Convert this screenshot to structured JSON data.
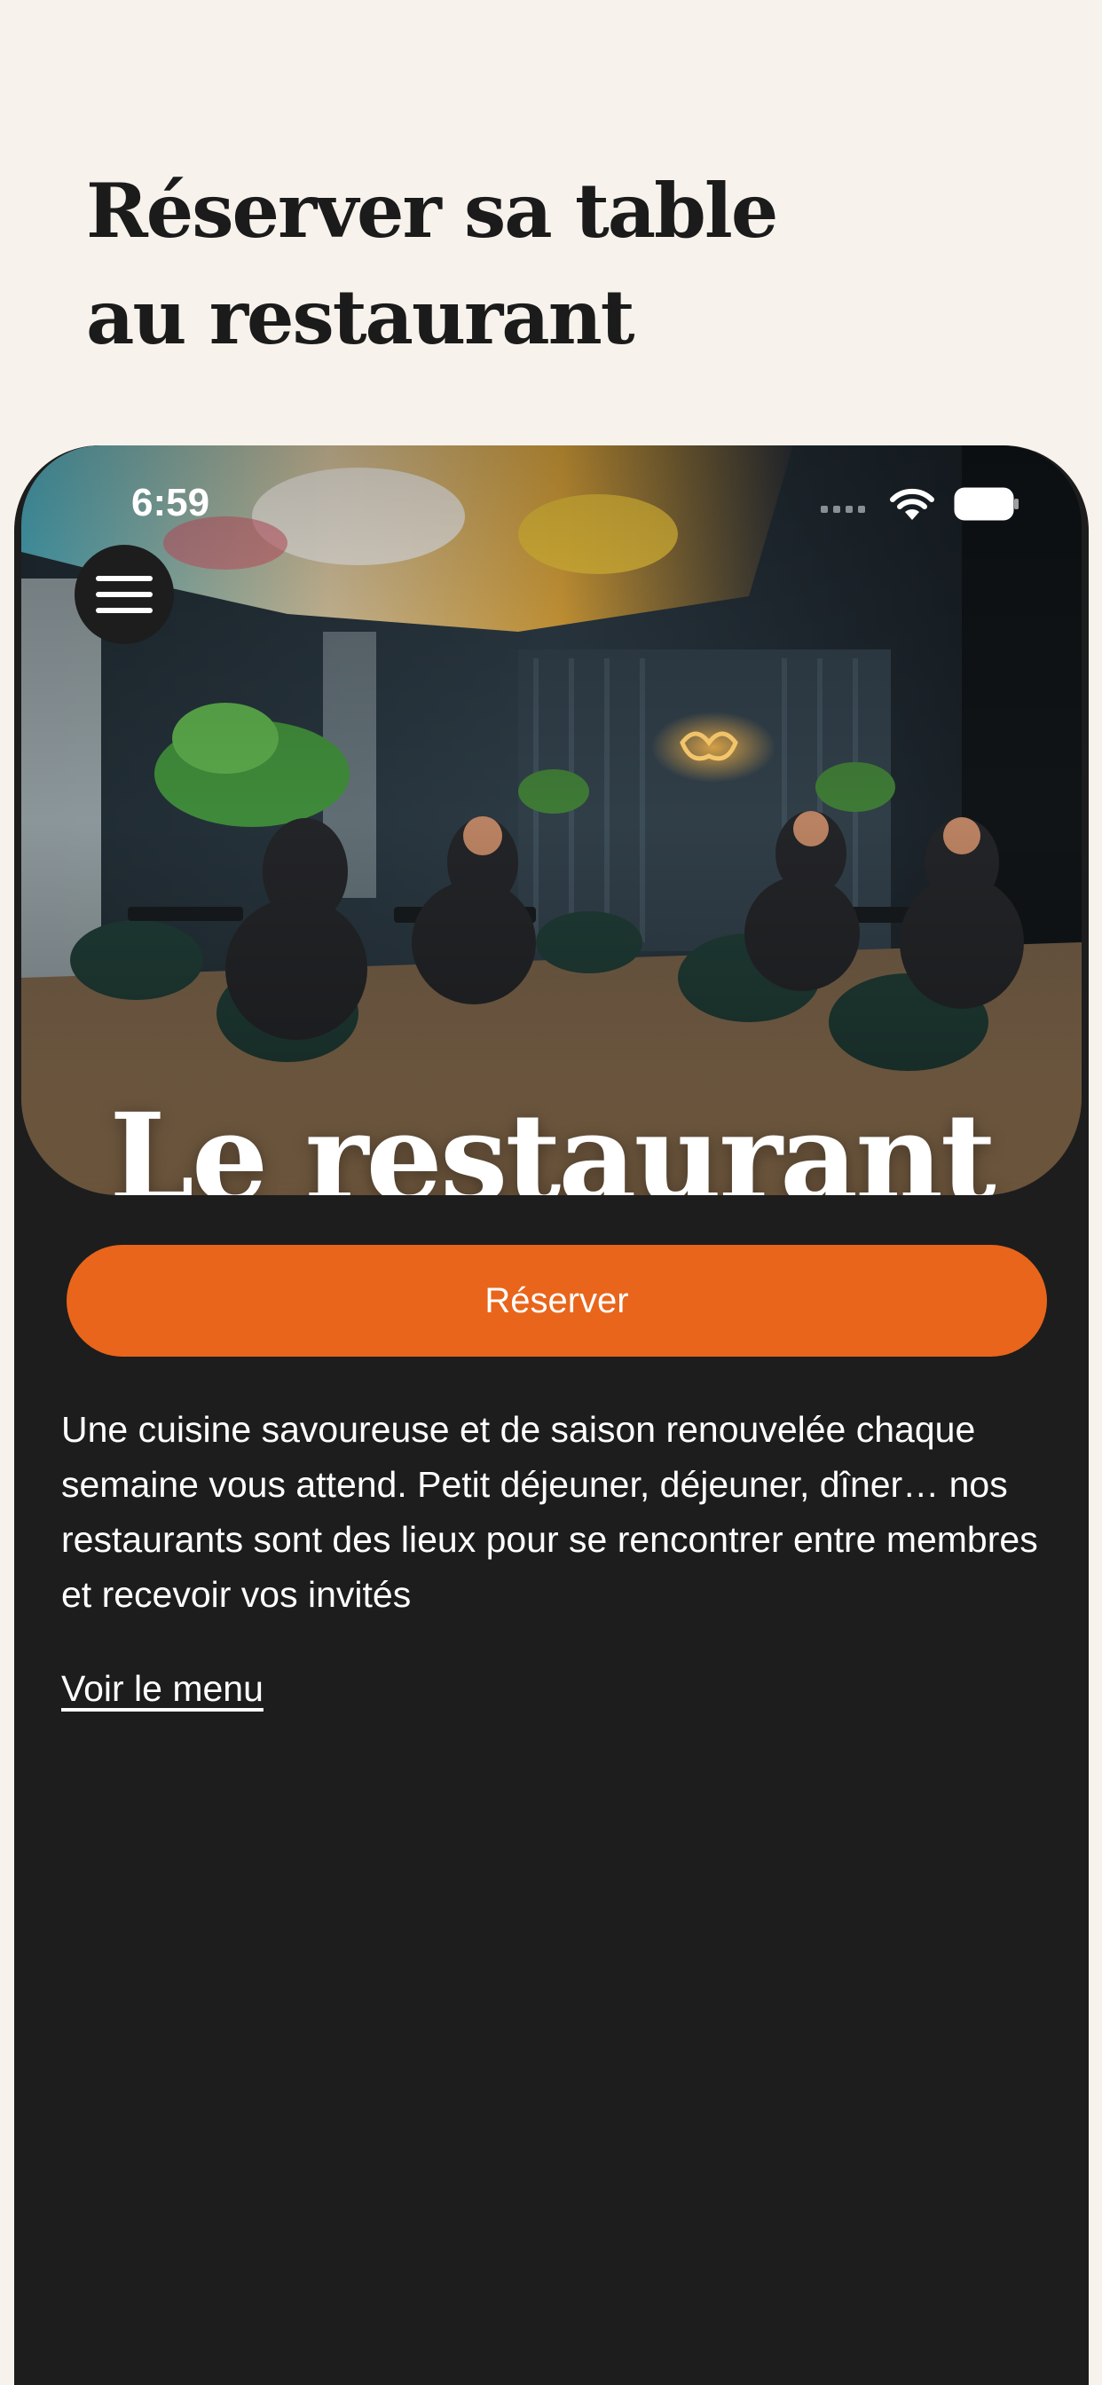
{
  "page": {
    "title_line1": "Réserver sa table",
    "title_line2": "au restaurant"
  },
  "status_bar": {
    "time": "6:59",
    "icons": [
      "cellular-signal-icon",
      "wifi-icon",
      "battery-icon"
    ]
  },
  "hero": {
    "title": "Le restaurant",
    "image": "restaurant-dining-room-photo",
    "menu_icon": "hamburger-menu-icon"
  },
  "actions": {
    "reserve_label": "Réserver"
  },
  "content": {
    "description": "Une cuisine savoureuse et de saison renouvelée chaque semaine vous attend. Petit déjeuner, déjeuner, dîner… nos restaurants sont des lieux pour se rencontrer entre membres et recevoir vos invités",
    "menu_link_label": "Voir le menu"
  },
  "colors": {
    "page_background": "#f8f2ec",
    "panel_background": "#1d1d1d",
    "accent": "#e8651b",
    "text_dark": "#1b1b1b",
    "text_light": "#ffffff"
  }
}
